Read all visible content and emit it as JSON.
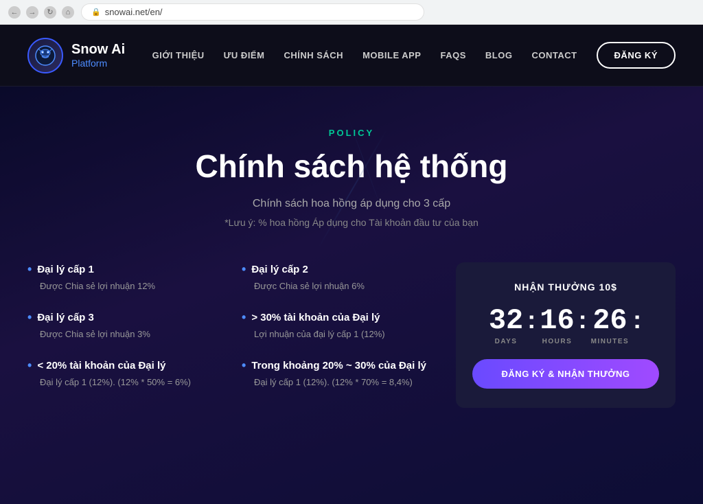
{
  "browser": {
    "url": "snowai.net/en/",
    "lock_symbol": "🔒"
  },
  "navbar": {
    "logo_icon": "🤖",
    "logo_title": "Snow Ai",
    "logo_subtitle": "Platform",
    "nav_items": [
      {
        "label": "GIỚI THIỆU",
        "id": "about"
      },
      {
        "label": "ƯU ĐIỂM",
        "id": "advantages"
      },
      {
        "label": "CHÍNH SÁCH",
        "id": "policy"
      },
      {
        "label": "MOBILE APP",
        "id": "mobile"
      },
      {
        "label": "FAQS",
        "id": "faqs"
      },
      {
        "label": "BLOG",
        "id": "blog"
      },
      {
        "label": "CONTACT",
        "id": "contact"
      }
    ],
    "register_btn": "ĐĂNG KÝ"
  },
  "hero": {
    "policy_label": "POLICY",
    "title": "Chính sách hệ thống",
    "subtitle": "Chính sách hoa hồng áp dụng cho 3 cấp",
    "note": "*Lưu ý: % hoa hồng Áp dụng cho Tài khoản đầu tư của bạn"
  },
  "policy_left": [
    {
      "title": "Đại lý cấp 1",
      "desc": "Được Chia sẻ lợi nhuận 12%"
    },
    {
      "title": "Đại lý cấp 3",
      "desc": "Được Chia sẻ lợi nhuận 3%"
    },
    {
      "title": "< 20% tài khoản của Đại lý",
      "desc": "Đại lý cấp 1 (12%). (12% * 50% = 6%)"
    }
  ],
  "policy_right": [
    {
      "title": "Đại lý cấp 2",
      "desc": "Được Chia sẻ lợi nhuận 6%"
    },
    {
      "title": "> 30% tài khoản của Đại lý",
      "desc": "Lợi nhuận của đại lý cấp 1 (12%)"
    },
    {
      "title": "Trong khoảng 20% ~ 30% của Đại lý",
      "desc": "Đại lý cấp 1 (12%). (12% * 70% = 8,4%)"
    }
  ],
  "countdown": {
    "title": "NHẬN THƯỞNG 10$",
    "days_value": "32",
    "days_label": "DAYS",
    "hours_value": "16",
    "hours_label": "HOURS",
    "minutes_value": "26",
    "minutes_label": "MINUTES",
    "btn_label": "ĐĂNG KÝ & NHẬN THƯỞNG"
  }
}
